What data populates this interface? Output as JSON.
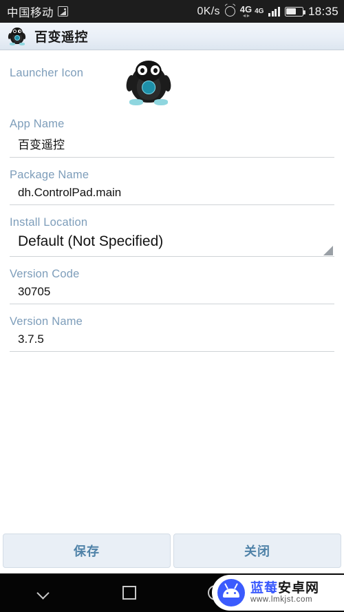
{
  "statusbar": {
    "carrier": "中国移动",
    "sim_icon": "sim-card-icon",
    "network_speed": "0K/s",
    "alarm_icon": "alarm-clock-icon",
    "network_type_primary": "4G",
    "network_type_secondary": "4G",
    "signal_icon": "signal-bars-icon",
    "battery_icon": "battery-icon",
    "battery_level_percent": "60",
    "time": "18:35"
  },
  "appbar": {
    "icon": "penguin-app-icon",
    "title": "百变遥控"
  },
  "form": {
    "launcher_icon": {
      "label": "Launcher Icon",
      "icon": "penguin-launcher-icon"
    },
    "fields": [
      {
        "label": "App Name",
        "value": "百变遥控",
        "type": "text"
      },
      {
        "label": "Package Name",
        "value": "dh.ControlPad.main",
        "type": "text"
      },
      {
        "label": "Install Location",
        "value": "Default (Not Specified)",
        "type": "spinner"
      },
      {
        "label": "Version Code",
        "value": "30705",
        "type": "text"
      },
      {
        "label": "Version Name",
        "value": "3.7.5",
        "type": "text"
      }
    ]
  },
  "footer": {
    "save_label": "保存",
    "close_label": "关闭"
  },
  "navbar": {
    "back_icon": "chevron-down-icon",
    "recents_icon": "square-icon",
    "home_icon": "circle-icon"
  },
  "watermark": {
    "logo": "android-robot-logo",
    "site_name_blue": "蓝莓",
    "site_name_black": "安卓网",
    "url": "www.lmkjst.com"
  },
  "colors": {
    "label_blue": "#7d9dba",
    "button_text": "#4f82a8",
    "button_bg": "#e9eff6",
    "statusbar_bg": "#1d1d1d",
    "appbar_bg": "#e9eff7",
    "watermark_blue": "#3b5bfd"
  }
}
